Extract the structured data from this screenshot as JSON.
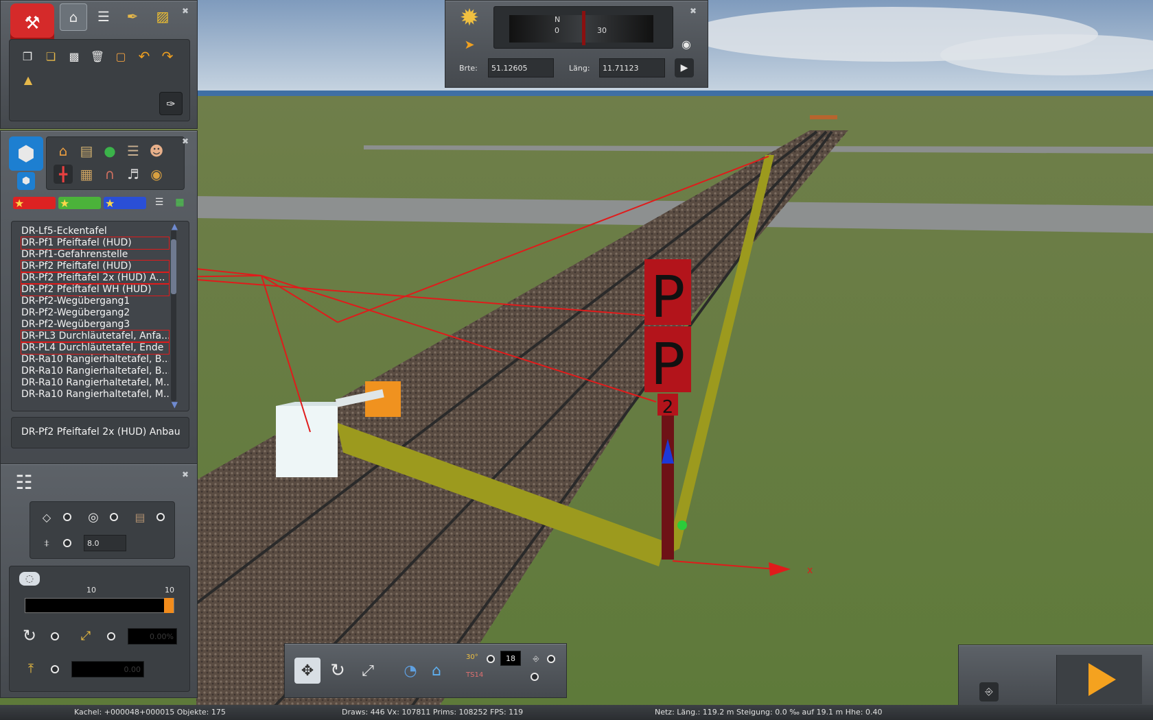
{
  "compass": {
    "n_label": "N",
    "tick_0": "0",
    "tick_30": "30",
    "lat_label": "Brte:",
    "lat_value": "51.12605",
    "lon_label": "Läng:",
    "lon_value": "11.71123"
  },
  "object_list": {
    "items": [
      {
        "label": "DR-Lf5-Eckentafel",
        "marked": false
      },
      {
        "label": "DR-Pf1 Pfeiftafel (HUD)",
        "marked": true
      },
      {
        "label": "DR-Pf1-Gefahrenstelle",
        "marked": false
      },
      {
        "label": "DR-Pf2 Pfeiftafel (HUD)",
        "marked": true
      },
      {
        "label": "DR-Pf2 Pfeiftafel 2x (HUD) A...",
        "marked": true
      },
      {
        "label": "DR-Pf2 Pfeiftafel WH (HUD)",
        "marked": true
      },
      {
        "label": "DR-Pf2-Wegübergang1",
        "marked": false
      },
      {
        "label": "DR-Pf2-Wegübergang2",
        "marked": false
      },
      {
        "label": "DR-Pf2-Wegübergang3",
        "marked": false
      },
      {
        "label": "DR-PL3 Durchläutetafel, Anfa...",
        "marked": true
      },
      {
        "label": "DR-PL4 Durchläutetafel, Ende",
        "marked": true
      },
      {
        "label": "DR-Ra10 Rangierhaltetafel, B...",
        "marked": false
      },
      {
        "label": "DR-Ra10 Rangierhaltetafel, B...",
        "marked": false
      },
      {
        "label": "DR-Ra10 Rangierhaltetafel, M...",
        "marked": false
      },
      {
        "label": "DR-Ra10 Rangierhaltetafel, M...",
        "marked": false
      }
    ],
    "selected": "DR-Pf2 Pfeiftafel 2x (HUD) Anbau"
  },
  "options": {
    "spacing_value": "8.0"
  },
  "tools": {
    "slider_min": "10",
    "slider_max": "10",
    "slider_level": 1.0,
    "rotate_value": "0.00%",
    "height_value": "0.00"
  },
  "bottom_toolbar": {
    "angle_label": "30°",
    "angle_value": "18",
    "ts_label": "TS14"
  },
  "sign": {
    "letter_top": "P",
    "letter_bottom": "P",
    "number": "2"
  },
  "axis_label": "x",
  "status": {
    "tile": "Kachel: +000048+000015 Objekte: 175",
    "draws": "Draws: 446 Vx: 107811 Prims: 108252 FPS: 119",
    "net": "Netz: Läng.: 119.2 m Steigung: 0.0 ‰ auf 19.1 m Hhe: 0.40"
  },
  "colors": {
    "panel": "#4d5258",
    "highlight": "#e01b1b",
    "slider_knob": "#f28c1c",
    "sign_red": "#b3141b",
    "band": "#9c9a1e"
  }
}
